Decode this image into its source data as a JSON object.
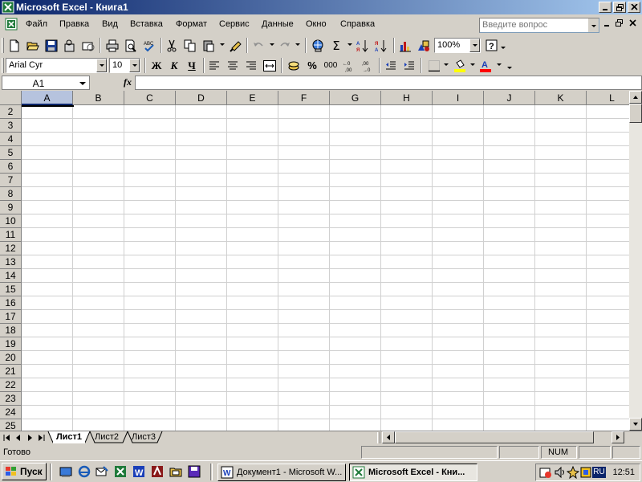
{
  "window": {
    "title": "Microsoft Excel - Книга1"
  },
  "menu": {
    "items": [
      "Файл",
      "Правка",
      "Вид",
      "Вставка",
      "Формат",
      "Сервис",
      "Данные",
      "Окно",
      "Справка"
    ],
    "question_placeholder": "Введите вопрос"
  },
  "toolbar": {
    "zoom": "100%"
  },
  "format_toolbar": {
    "font": "Arial Cyr",
    "size": "10",
    "bold": "Ж",
    "italic": "К",
    "underline": "Ч",
    "percent": "%",
    "thousands": "000"
  },
  "formula_bar": {
    "name_box": "A1",
    "fx": "fx",
    "value": ""
  },
  "grid": {
    "columns": [
      "A",
      "B",
      "C",
      "D",
      "E",
      "F",
      "G",
      "H",
      "I",
      "J",
      "K",
      "L"
    ],
    "rows": [
      "2",
      "3",
      "4",
      "5",
      "6",
      "7",
      "8",
      "9",
      "10",
      "11",
      "12",
      "13",
      "14",
      "15",
      "16",
      "17",
      "18",
      "19",
      "20",
      "21",
      "22",
      "23",
      "24",
      "25"
    ],
    "active_cell": "A1"
  },
  "sheets": [
    "Лист1",
    "Лист2",
    "Лист3"
  ],
  "status": {
    "ready": "Готово",
    "num": "NUM"
  },
  "taskbar": {
    "start": "Пуск",
    "tasks": [
      "Документ1 - Microsoft W...",
      "Microsoft Excel - Кни..."
    ],
    "lang": "RU",
    "clock": "12:51"
  },
  "colors": {
    "title_start": "#0a246a",
    "title_end": "#a6caf0",
    "face": "#d4d0c8",
    "active_header": "#b6c3de"
  }
}
